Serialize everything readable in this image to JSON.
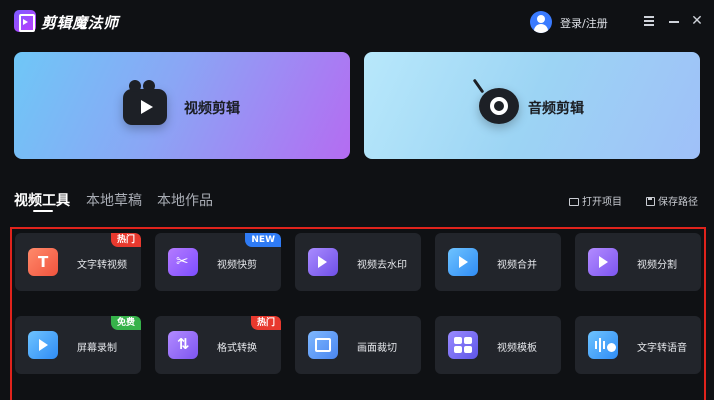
{
  "app": {
    "title": "剪辑魔法师"
  },
  "header": {
    "login_label": "登录/注册",
    "close_glyph": "✕"
  },
  "cards": {
    "video_edit": "视频剪辑",
    "audio_edit": "音频剪辑"
  },
  "tabs": [
    {
      "label": "视频工具",
      "active": true
    },
    {
      "label": "本地草稿",
      "active": false
    },
    {
      "label": "本地作品",
      "active": false
    }
  ],
  "actions": {
    "open_project": "打开项目",
    "save_path": "保存路径"
  },
  "tools": [
    {
      "label": "文字转视频",
      "icon": "text-to-video-icon",
      "badge": "热门",
      "badge_color": "#e8392e"
    },
    {
      "label": "视频快剪",
      "icon": "scissors-icon",
      "badge": "NEW",
      "badge_color": "#2f7bf5"
    },
    {
      "label": "视频去水印",
      "icon": "remove-watermark-icon"
    },
    {
      "label": "视频合并",
      "icon": "merge-video-icon"
    },
    {
      "label": "视频分割",
      "icon": "split-video-icon"
    },
    {
      "label": "屏幕录制",
      "icon": "screen-record-icon",
      "badge": "免费",
      "badge_color": "#36b24a"
    },
    {
      "label": "格式转换",
      "icon": "format-convert-icon",
      "badge": "热门",
      "badge_color": "#e8392e"
    },
    {
      "label": "画面裁切",
      "icon": "crop-icon"
    },
    {
      "label": "视频模板",
      "icon": "template-icon"
    },
    {
      "label": "文字转语音",
      "icon": "text-to-speech-icon"
    }
  ],
  "icon_glyphs": {
    "text_to_video": "T",
    "scissors": "✂",
    "format_convert": "⇅"
  }
}
